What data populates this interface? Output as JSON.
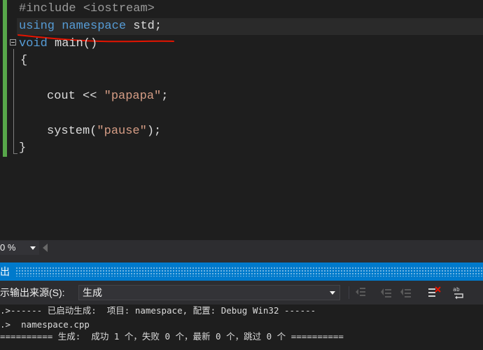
{
  "editor": {
    "lines": {
      "include": {
        "directive": "#include",
        "header": " <iostream>"
      },
      "using": {
        "kw_using": "using",
        "kw_namespace": "namespace",
        "rest": " std;"
      },
      "main": {
        "kw_void": "void",
        "rest": " main()"
      },
      "open_brace": "{",
      "cout": {
        "text": "cout << ",
        "literal": "\"papapa\"",
        "end": ";"
      },
      "system": {
        "text": "system(",
        "literal": "\"pause\"",
        "end": ");"
      },
      "close_brace": "}"
    },
    "annotation_color": "#e51400",
    "change_margin_color": "#57a64a"
  },
  "zoom": {
    "value": "0 %"
  },
  "output": {
    "title": "出",
    "source_label": "示输出来源(S):",
    "source_value": "生成",
    "lines": [
      ".>------ 已启动生成:  项目: namespace, 配置: Debug Win32 ------",
      ".>  namespace.cpp",
      "========== 生成:  成功 1 个，失败 0 个，最新 0 个，跳过 0 个 =========="
    ],
    "toolbar_icons": [
      "goto-previous-message-icon",
      "find-previous-message-icon",
      "find-next-message-icon",
      "clear-all-icon",
      "toggle-word-wrap-icon"
    ]
  },
  "colors": {
    "accent": "#007acc",
    "keyword": "#569cd6",
    "string": "#d69d85"
  }
}
